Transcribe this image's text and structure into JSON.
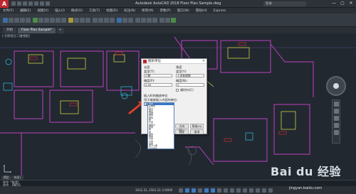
{
  "titlebar": {
    "title": "Autodesk AutoCAD 2018  Floor Plan Sample.dwg",
    "signin": "登录",
    "minimize": "—",
    "maximize": "▢",
    "close": "✕"
  },
  "menubar": {
    "items": [
      "文件(F)",
      "编辑(E)",
      "视图(V)",
      "插入(I)",
      "格式(O)",
      "工具(T)",
      "绘图(D)",
      "标注(N)",
      "修改(M)",
      "参数(P)",
      "窗口(W)",
      "帮助(H)",
      "Express"
    ]
  },
  "doctabs": {
    "tabs": [
      "开始",
      "Floor Plan Sample*"
    ],
    "add": "+"
  },
  "viewport_label": "[-][俯视][二维线框]",
  "dialog": {
    "title": "图形单位",
    "close": "×",
    "length_section": "长度",
    "length_type_label": "类型(T):",
    "length_type_value": "小数",
    "length_precision_label": "精度(P):",
    "length_precision_value": "0.00",
    "angle_section": "角度",
    "angle_type_label": "类型(Y):",
    "angle_type_value": "十进制度数",
    "angle_precision_label": "精度(N):",
    "angle_precision_value": "0",
    "clockwise_label": "顺时针(C)",
    "insert_section": "插入时的缩放单位",
    "insert_label": "用于缩放插入内容的单位:",
    "insert_value": "毫米",
    "ok": "确定",
    "cancel": "取消",
    "direction": "方向(D)...",
    "help": "帮助(H)"
  },
  "dropdown": {
    "items": [
      "毫米",
      "无单位",
      "英寸",
      "英尺",
      "英里",
      "毫米",
      "厘米",
      "米",
      "千米",
      "微英寸",
      "密耳",
      "码",
      "埃",
      "纳米",
      "微米",
      "分米",
      "十米",
      "百米",
      "百万公里",
      "天文单位",
      "光年",
      "秒差距",
      "美国测量英尺"
    ],
    "selected_index": 0
  },
  "model_tabs": [
    "模型",
    "布局1"
  ],
  "command": {
    "line1": "命令: *取消*",
    "line2": "命令: _UNITS"
  },
  "status": {
    "coords": "1012.31, 1501.22, 0.0000"
  },
  "watermark": {
    "brand": "Bai du 经验",
    "url": "jingyan.baidu.com"
  }
}
